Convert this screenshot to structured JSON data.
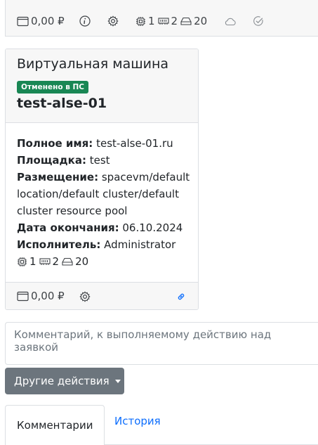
{
  "top_card": {
    "price": "0,00 ₽",
    "cpu": "1",
    "ram": "2",
    "disk": "20"
  },
  "vm_card": {
    "type_title": "Виртуальная машина",
    "status_badge": "Отменено в ПС",
    "name": "test-alse-01",
    "fields": {
      "full_name_label": "Полное имя:",
      "full_name_value": "test-alse-01.ru",
      "site_label": "Площадка:",
      "site_value": "test",
      "placement_label": "Размещение:",
      "placement_value_line1": "spacevm/default",
      "placement_value_line2": "location/default cluster/default",
      "placement_value_line3": "cluster resource pool",
      "end_date_label": "Дата окончания:",
      "end_date_value": "06.10.2024",
      "executor_label": "Исполнитель:",
      "executor_value": "Administrator"
    },
    "specs": {
      "cpu": "1",
      "ram": "2",
      "disk": "20"
    },
    "footer": {
      "price": "0,00 ₽"
    }
  },
  "comment": {
    "placeholder": "Комментарий, к выполняемому действию над заявкой"
  },
  "actions": {
    "other_actions_label": "Другие действия"
  },
  "tabs": [
    {
      "label": "Комментарии"
    },
    {
      "label": "История"
    }
  ],
  "colors": {
    "badge_green": "#198754",
    "link_blue": "#0d6efd",
    "secondary_button": "#6c757d"
  }
}
